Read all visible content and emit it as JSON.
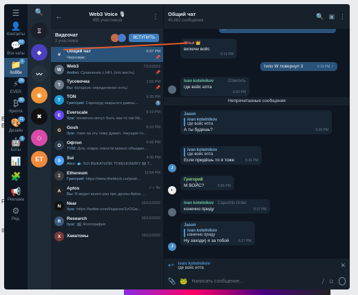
{
  "page": {
    "side_marks": [
      "B",
      "B",
      "F",
      "Ih"
    ]
  },
  "folders": {
    "items": [
      {
        "label": "Контакты",
        "icon": "👤",
        "badge": ""
      },
      {
        "label": "Все чаты",
        "icon": "💬",
        "badge": "52"
      },
      {
        "label": "Хобби",
        "icon": "📁",
        "badge": "1"
      },
      {
        "label": "EVER",
        "icon": "⚡",
        "badge": "29"
      },
      {
        "label": "Крипта",
        "icon": "₿",
        "badge": "30"
      },
      {
        "label": "Дизайн",
        "icon": "🎨",
        "badge": "11"
      },
      {
        "label": "Боты",
        "icon": "🤖",
        "badge": "1"
      },
      {
        "label": "",
        "icon": "📊",
        "badge": ""
      },
      {
        "label": "",
        "icon": "🧩",
        "badge": ""
      },
      {
        "label": "Реклама",
        "icon": "📢",
        "badge": ""
      },
      {
        "label": "Ред.",
        "icon": "⚙",
        "badge": ""
      }
    ]
  },
  "strip": {
    "avatars": [
      {
        "text": "Ξ",
        "color": "#1b1f2a",
        "badge": ""
      },
      {
        "text": "◆",
        "color": "#4a40c0",
        "badge": ""
      },
      {
        "text": "〰",
        "color": "#26333f",
        "badge": ""
      },
      {
        "text": "◉",
        "color": "#f1963a",
        "badge": ""
      },
      {
        "text": "✖",
        "color": "#111111",
        "badge": ""
      },
      {
        "text": "◇",
        "color": "#d94ba8",
        "badge": ""
      },
      {
        "text": "ET",
        "color": "#f08a3c",
        "badge": ""
      }
    ]
  },
  "list": {
    "title": "Web3 Voice 🎙",
    "subtitle": "495 участников",
    "videochat": {
      "title": "Видеочат",
      "subtitle": "2 участника",
      "join": "ВСТУПИТЬ"
    },
    "chats": [
      {
        "name": "Общий чат",
        "time": "6:37 PM",
        "sender": "",
        "preview": "Черновик:",
        "avatar": "#",
        "color": "#2b5278",
        "badge": "",
        "pin": "📌",
        "active": true
      },
      {
        "name": "Web3",
        "time": "7/12/2022",
        "sender": "Andrei:",
        "preview": "Сравнение с HFL (это жесть)",
        "avatar": "W",
        "color": "#5b6b7b",
        "badge": "",
        "pin": "📌",
        "active": false
      },
      {
        "name": "Тусовочка",
        "time": "1:59 PM",
        "sender": "Вы:",
        "preview": "Катарсис определенно есть)",
        "avatar": "T",
        "color": "#6c7a89",
        "badge": "",
        "pin": "📌",
        "active": false
      },
      {
        "name": "TON",
        "time": "6:35 PM",
        "sender": "Григорий:",
        "preview": "Сиркоруд закрылся давны...",
        "avatar": "T",
        "color": "#1b9bd7",
        "badge": "1",
        "pin": "",
        "active": false
      },
      {
        "name": "Everscale",
        "time": "6:19 PM",
        "sender": "Ilyar:",
        "preview": "косвенно могут быть как-то так htt...",
        "avatar": "E",
        "color": "#6347f5",
        "badge": "",
        "pin": "",
        "active": false
      },
      {
        "name": "Gosh",
        "time": "6:10 PM",
        "sender": "Ilyar:",
        "preview": "тоже на эту тему думал. текущая то...",
        "avatar": "G",
        "color": "#222222",
        "badge": "",
        "pin": "",
        "active": false
      },
      {
        "name": "Офтоп",
        "time": "6:09 PM",
        "sender": "TVM:",
        "preview": "Для, новую локости можно объедин...",
        "avatar": "О",
        "color": "#2a3a4a",
        "badge": "",
        "pin": "",
        "active": false
      },
      {
        "name": "Sui",
        "time": "4:30 PM",
        "sender": "Alex:",
        "preview": "🐟 SUI ВЫКАТИЛИ ТОКЕНОМИКУ 😱 Т...",
        "avatar": "S",
        "color": "#4da2ff",
        "badge": "",
        "pin": "",
        "active": false
      },
      {
        "name": "Ethereum",
        "time": "11:54 PM",
        "sender": "Григорий:",
        "preview": "https://www.theblock.co/post/...",
        "avatar": "Ξ",
        "color": "#3c3c3d",
        "badge": "",
        "pin": "",
        "active": false
      },
      {
        "name": "Aptos",
        "time": "✓✓ Вт",
        "sender": "Вы:",
        "preview": "Я видел много раз про дропы Aptos ...",
        "avatar": "A",
        "color": "#222222",
        "badge": "",
        "pin": "",
        "active": false
      },
      {
        "name": "Near",
        "time": "10/12/2022",
        "sender": "Ilyar:",
        "preview": "https://twitter.com/i/spaces/1vOGw...",
        "avatar": "N",
        "color": "#111111",
        "badge": "",
        "pin": "",
        "active": false
      },
      {
        "name": "Research",
        "time": "10/12/2022",
        "sender": "Ilyar:",
        "preview": "🖼 Фотография",
        "avatar": "R",
        "color": "#3a5a7a",
        "badge": "",
        "pin": "",
        "active": false
      },
      {
        "name": "Хакатоны",
        "time": "10/12/2022",
        "sender": "",
        "preview": "",
        "avatar": "Х",
        "color": "#7a3a3a",
        "badge": "",
        "pin": "",
        "active": false
      }
    ]
  },
  "conv": {
    "title": "Общий чат",
    "subtitle": "45,682 сообщения",
    "messages": {
      "top_cut": "...",
      "m1": {
        "name": "Илья 👑",
        "text": "включи войс",
        "time": "6:19 PM"
      },
      "m2": {
        "text": "типо W повернул 3",
        "time": "6:19 PM ✓"
      },
      "m3": {
        "name": "ivan kotelnikov",
        "text": "где войс епта",
        "time": "6:30 PM",
        "reply": "Ответить"
      },
      "unread": "Непрочитанные сообщения",
      "m4": {
        "name": "Jason",
        "qname": "ivan kotelnikov",
        "qtext": "где войс епта",
        "text": "А ты будешь?",
        "time": "6:36 PM"
      },
      "m5": {
        "qname": "ivan kotelnikov",
        "qtext": "где войс епта",
        "text": "Если придёшь то я тоже",
        "time": "6:36 PM"
      },
      "m6": {
        "name": "Григорий",
        "text": "М ВОЙС?",
        "time": "6:36 PM"
      },
      "m7": {
        "name": "ivan kotelnikov",
        "tag": "Capuchin Order",
        "text": "конечно приду",
        "time": "6:37 PM"
      },
      "m8": {
        "name": "Jason",
        "qname": "ivan kotelnikov",
        "qtext": "конечно приду",
        "text": "Ну заходи) я за тобой",
        "time": "6:37 PM"
      }
    },
    "reply": {
      "name": "ivan kotelnikov",
      "text": "где войс епта"
    },
    "input": {
      "placeholder": "Написать сообщение..."
    }
  }
}
